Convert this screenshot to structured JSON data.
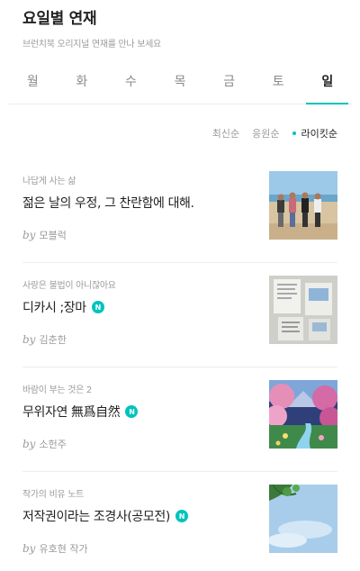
{
  "header": {
    "title": "요일별 연재",
    "subtitle": "브런치북 오리지널 연재를 만나 보세요"
  },
  "tabs": [
    {
      "label": "월",
      "active": false
    },
    {
      "label": "화",
      "active": false
    },
    {
      "label": "수",
      "active": false
    },
    {
      "label": "목",
      "active": false
    },
    {
      "label": "금",
      "active": false
    },
    {
      "label": "토",
      "active": false
    },
    {
      "label": "일",
      "active": true
    }
  ],
  "sort": {
    "options": [
      "최신순",
      "응원순",
      "라이킷순"
    ],
    "active": "라이킷순"
  },
  "accent_color": "#00c3bd",
  "by_label": "by",
  "badge_letter": "N",
  "articles": [
    {
      "magazine": "나답게 사는 삶",
      "title": "젊은 날의 우정, 그 찬란함에 대해.",
      "author": "모블럭",
      "new_badge": false,
      "thumbnail": "beach-friends-photo"
    },
    {
      "magazine": "사랑은 불법이 아니잖아요",
      "title": "디카시 ;장마",
      "author": "김춘한",
      "new_badge": true,
      "thumbnail": "wall-notes-photo"
    },
    {
      "magazine": "바람이 부는 것은 2",
      "title": "무위자연 無爲自然",
      "author": "소헌주",
      "new_badge": true,
      "thumbnail": "blossom-river-painting"
    },
    {
      "magazine": "작가의 비유 노트",
      "title": "저작권이라는 조경사(공모전)",
      "author": "유호현 작가",
      "new_badge": true,
      "thumbnail": "sky-leaves-photo"
    }
  ]
}
